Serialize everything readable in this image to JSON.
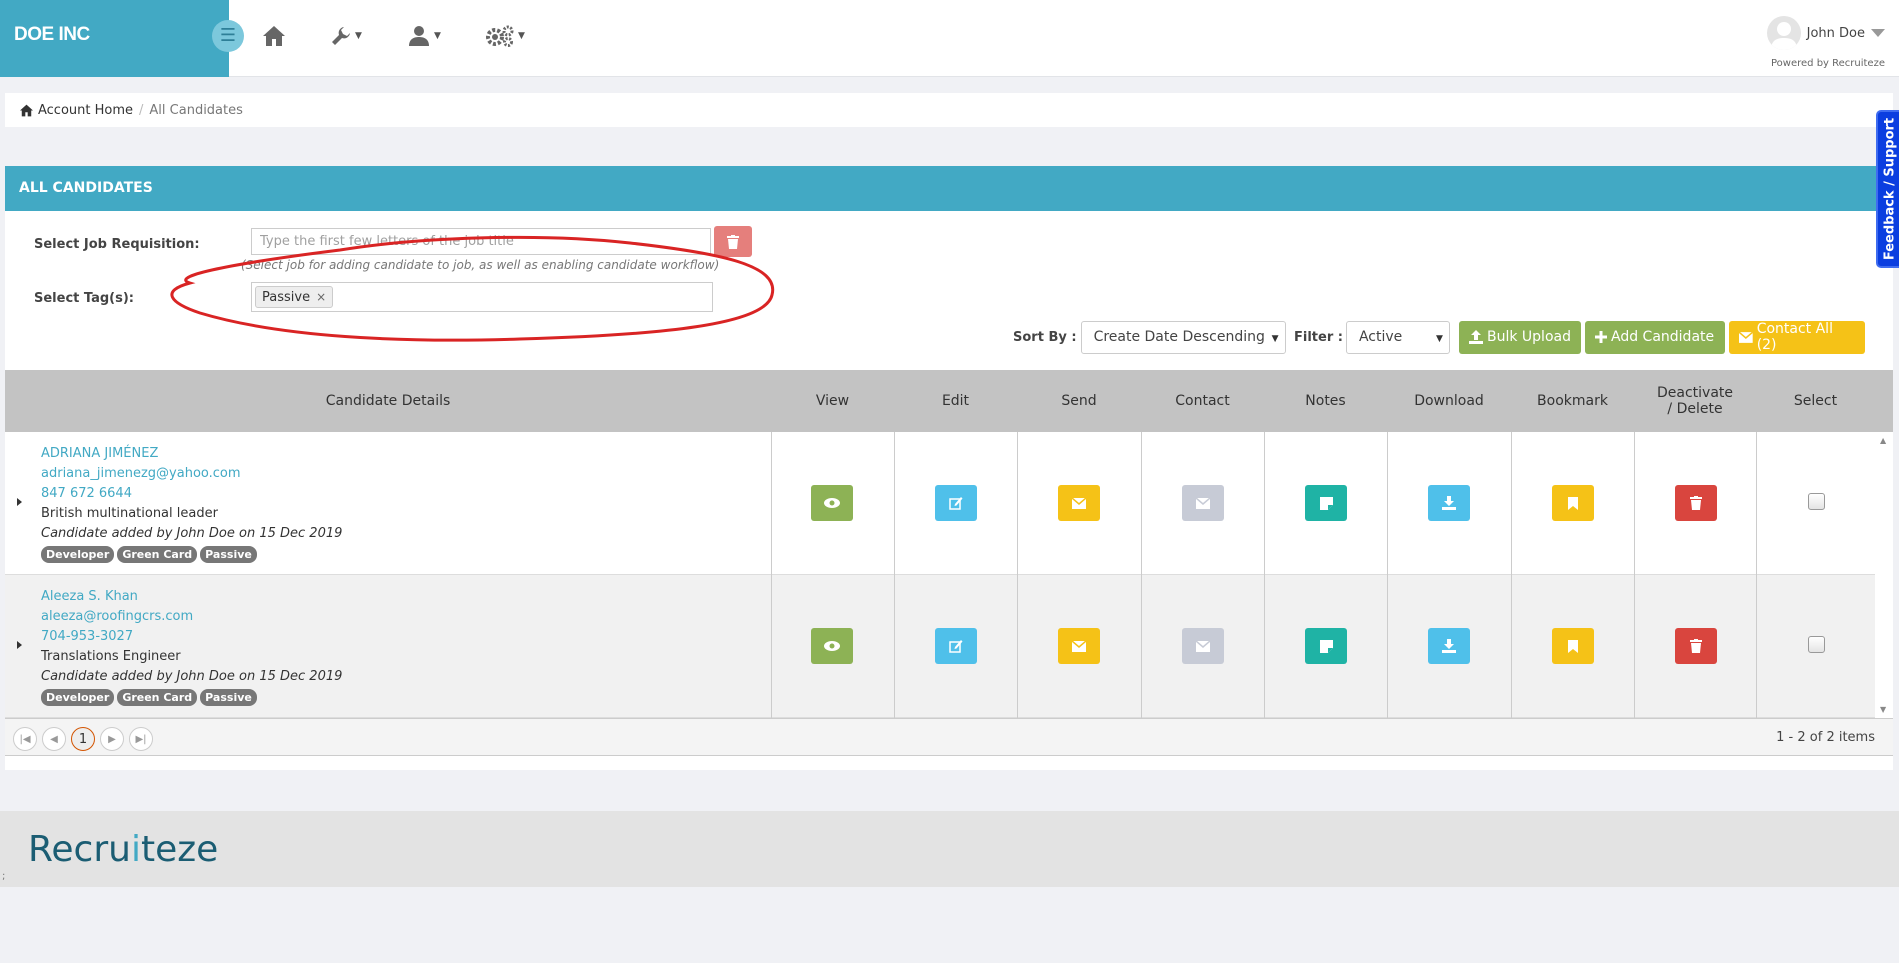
{
  "header": {
    "brand": "DOE INC",
    "user_name": "John Doe",
    "powered_by": "Powered by Recruiteze"
  },
  "breadcrumb": {
    "home": "Account Home",
    "current": "All Candidates"
  },
  "panel": {
    "title": "ALL CANDIDATES",
    "job_label": "Select Job Requisition:",
    "job_placeholder": "Type the first few letters of the job title",
    "job_hint": "(Select job for adding candidate to job, as well as enabling candidate workflow)",
    "tags_label": "Select Tag(s):",
    "selected_tags": [
      "Passive"
    ],
    "sort_label": "Sort By :",
    "sort_value": "Create Date Descending",
    "filter_label": "Filter :",
    "filter_value": "Active",
    "bulk_upload": "Bulk Upload",
    "add_candidate": "Add Candidate",
    "contact_all": "Contact All (2)"
  },
  "grid": {
    "columns": [
      "Candidate Details",
      "View",
      "Edit",
      "Send",
      "Contact",
      "Notes",
      "Download",
      "Bookmark",
      "Deactivate / Delete",
      "Select"
    ],
    "rows": [
      {
        "name": "ADRIANA JIMÉNEZ",
        "email": "adriana_jimenezg@yahoo.com",
        "phone": "847 672 6644",
        "title": "British multinational leader",
        "added": "Candidate added by John Doe on 15 Dec 2019",
        "tags": [
          "Developer",
          "Green Card",
          "Passive"
        ]
      },
      {
        "name": "Aleeza S. Khan",
        "email": "aleeza@roofingcrs.com",
        "phone": "704-953-3027",
        "title": "Translations Engineer",
        "added": "Candidate added by John Doe on 15 Dec 2019",
        "tags": [
          "Developer",
          "Green Card",
          "Passive"
        ]
      }
    ]
  },
  "pager": {
    "current_page": "1",
    "info": "1 - 2 of 2 items"
  },
  "footer": {
    "logo_a": "Recru",
    "logo_i": "i",
    "logo_b": "teze",
    "mark": ";"
  },
  "feedback": "Feedback / Support",
  "colors": {
    "brand": "#42a9c4",
    "view": "#8db255",
    "edit": "#4fc0ea",
    "send": "#f5c217",
    "contact": "#c7cbd6",
    "notes": "#1fb3a5",
    "download": "#4fc0ea",
    "bookmark": "#f5c217",
    "delete": "#d9453e",
    "annotation": "#d92424"
  }
}
